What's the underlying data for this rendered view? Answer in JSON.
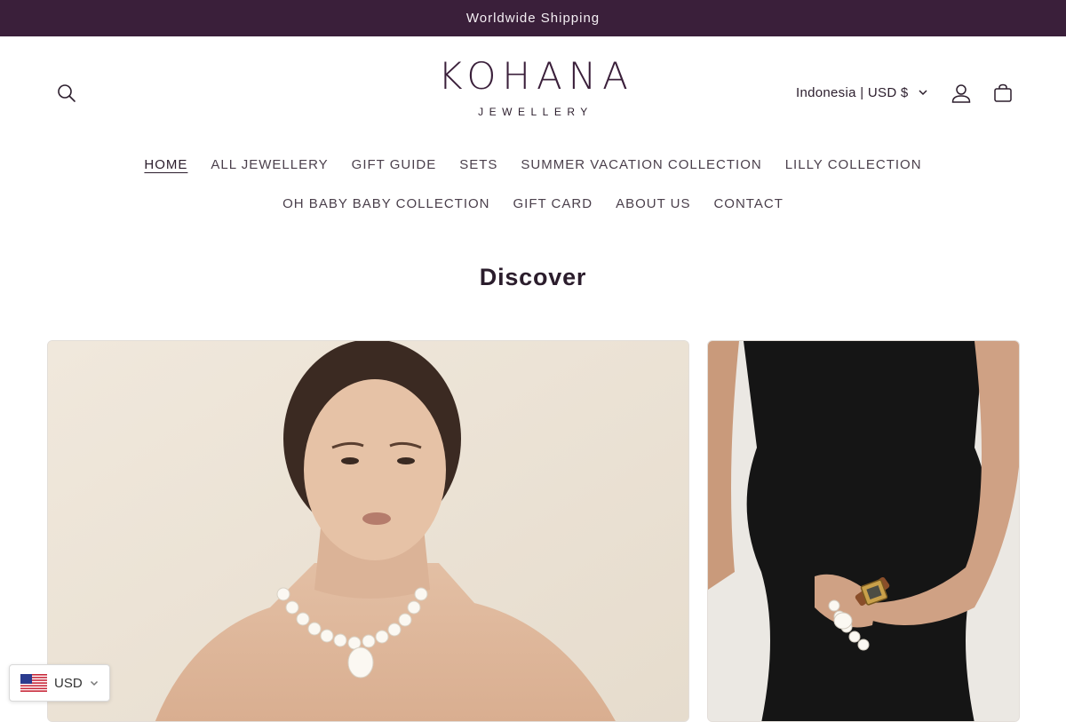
{
  "announcement": {
    "text": "Worldwide Shipping"
  },
  "header": {
    "logo_main": "KOHANA",
    "logo_sub": "JEWELLERY",
    "locale_label": "Indonesia | USD $",
    "icons": {
      "search": "search-icon",
      "account": "user-icon",
      "cart": "bag-icon",
      "chevron": "chevron-down-icon"
    }
  },
  "nav": {
    "row1": [
      "HOME",
      "ALL JEWELLERY",
      "GIFT GUIDE",
      "SETS",
      "SUMMER VACATION COLLECTION",
      "LILLY COLLECTION"
    ],
    "row2": [
      "OH BABY BABY COLLECTION",
      "GIFT CARD",
      "ABOUT US",
      "CONTACT"
    ],
    "active": "HOME"
  },
  "main": {
    "section_title": "Discover"
  },
  "currency_selector": {
    "value": "USD",
    "flag": "us-flag-icon"
  },
  "colors": {
    "announcement_bg": "#3a1f3a",
    "brand": "#3a1f3a",
    "text": "#2b1d2c"
  }
}
